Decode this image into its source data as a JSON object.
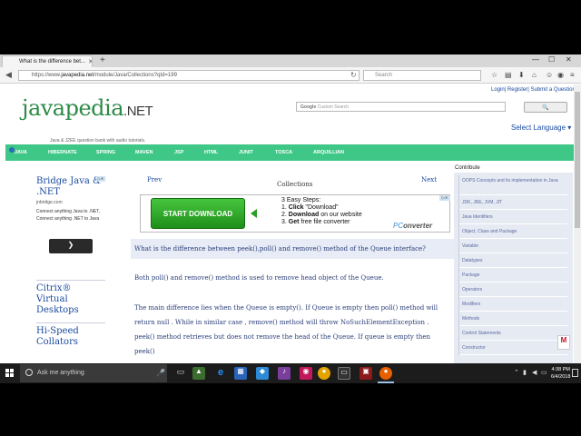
{
  "browser": {
    "tab_title": "What is the difference bet...",
    "tab_close": "✕",
    "new_tab": "+",
    "url_prefix": "https://www.",
    "url_host": "javapedia.net",
    "url_path": "/module/Java/Collections?qId=199",
    "search_placeholder": "Search"
  },
  "page": {
    "top_links": "Login| Register| Submit a Question",
    "logo_main": "javapedia",
    "logo_ext": ".NET",
    "tagline": "Java & J2EE question bank with audio tutorials.",
    "google_search_placeholder": "Custom Search",
    "google_search_brand": "Google",
    "google_button": "",
    "select_language": "Select Language",
    "menu": [
      "JAVA",
      "HIBERNATE",
      "SPRING",
      "MAVEN",
      "JSP",
      "HTML",
      "JUNIT",
      "TOSCA",
      "ARQUILLIAN"
    ],
    "prev": "Prev",
    "next": "Next",
    "section": "Collections",
    "question": "What is the difference between peek(),poll() and remove() method of the Queue interface?",
    "paragraph1": "Both poll() and remove() method is used to remove head object of the Queue.",
    "paragraph2": "The main difference lies when the Queue is empty(). If Queue is empty then poll() method will return null . While in similar case , remove() method will throw NoSuchElementException . peek() method retrieves but does not remove the head of the Queue. If queue is empty then peek()"
  },
  "ads": {
    "bridge_title": "Bridge Java & .NET",
    "bridge_domain": "jnbridge.com",
    "bridge_text": "Connect anything Java to .NET, Connect anything .NET to Java",
    "bridge_arrow": "❯",
    "citrix": "Citrix® Virtual Desktops",
    "hispeed": "Hi-Speed Collators",
    "banner_button": "START DOWNLOAD",
    "banner_steps_title": "3 Easy Steps:",
    "banner_step1_num": "1.",
    "banner_step1_verb": "Click",
    "banner_step1_rest": " \"Download\"",
    "banner_step2_num": "2.",
    "banner_step2_verb": "Download",
    "banner_step2_rest": " on our website",
    "banner_step3_num": "3.",
    "banner_step3_verb": "Get",
    "banner_step3_rest": " free file converter",
    "banner_brand_pc": "PC",
    "banner_brand_rest": "onverter"
  },
  "sidebar": {
    "title": "Contribute",
    "items": [
      "OOPS Concepts and its implementation in Java",
      "JDK, JRE, JVM, JIT",
      "Java Identifiers",
      "Object, Class and Package",
      "Variable",
      "Datatypes",
      "Package",
      "Operators",
      "Modifiers",
      "Methods",
      "Control Statements",
      "Constructor"
    ]
  },
  "taskbar": {
    "search_placeholder": "Ask me anything",
    "time": "4:38 PM",
    "date": "6/4/2018"
  },
  "colors": {
    "menu_green": "#3ec787",
    "logo_green": "#2c8a46",
    "link_blue": "#1a4aa0",
    "taskbar": "#1c1c1c"
  }
}
